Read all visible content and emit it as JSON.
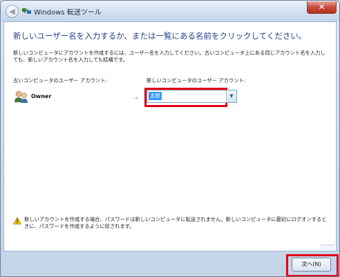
{
  "window": {
    "title": "Windows 転送ツール",
    "close_glyph": "✕",
    "back_glyph": "◀"
  },
  "main": {
    "heading": "新しいユーザー名を入力するか、または一覧にある名前をクリックしてください。",
    "description": "新しいコンピュータにアカウントを作成するには、ユーザー名を入力してください。古いコンピュータ上にある同じアカウント名を入力しても、新しいアカウント名を入力しても結構です。",
    "old_account_label": "古いコンピュータのユーザー アカウント:",
    "new_account_label": "新しいコンピュータのユーザー アカウント:",
    "old_user_name": "Owner",
    "new_user_value": "太郎",
    "warning": "新しいアカウントを作成する場合、パスワードは新しいコンピュータに転送されません。新しいコンピュータに最初にログオンするときに、パスワードを作成するように促されます。"
  },
  "footer": {
    "next_button": "次へ(N)"
  },
  "icons": {
    "back": "back-arrow-icon",
    "app": "transfer-app-icon",
    "user": "users-icon",
    "map_arrow": "arrow-right-icon",
    "dropdown": "chevron-down-icon",
    "warning": "warning-icon"
  },
  "colors": {
    "heading": "#1e3f8a",
    "highlight": "#e20016",
    "selection": "#3399ff"
  }
}
